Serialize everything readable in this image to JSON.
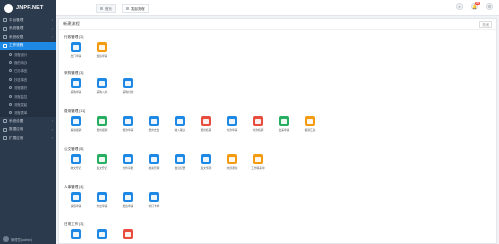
{
  "brand": {
    "name": "JNPF.NET"
  },
  "sidebar": {
    "items": [
      {
        "label": "平台管理",
        "active": false
      },
      {
        "label": "系统管理",
        "active": false
      },
      {
        "label": "系统权限",
        "active": false
      },
      {
        "label": "工作流程",
        "active": true
      }
    ],
    "subitems": [
      {
        "label": "流程设计"
      },
      {
        "label": "我的待办"
      },
      {
        "label": "已办事宜"
      },
      {
        "label": "抄送事宜"
      },
      {
        "label": "流程委托"
      },
      {
        "label": "流程监控"
      },
      {
        "label": "流程发起"
      },
      {
        "label": "流程表单"
      }
    ],
    "more_items": [
      {
        "label": "系统设置"
      },
      {
        "label": "数据应用"
      },
      {
        "label": "扩展应用"
      }
    ],
    "footer_user": "管理员(admin)"
  },
  "topbar": {
    "tabs": [
      {
        "label": "首页"
      },
      {
        "label": "发起流程",
        "active": true
      }
    ],
    "notification_count": "99"
  },
  "panel": {
    "title": "新建流程",
    "close_label": "关闭"
  },
  "sections": [
    {
      "title": "行政管理 [2]",
      "apps": [
        {
          "label": "出门申请",
          "color": "#1e88e5"
        },
        {
          "label": "加班申请",
          "color": "#f39c12"
        }
      ]
    },
    {
      "title": "采购管理 [3]",
      "apps": [
        {
          "label": "采购申请",
          "color": "#1e88e5"
        },
        {
          "label": "采购入库",
          "color": "#1e88e5"
        },
        {
          "label": "采购付款",
          "color": "#1e88e5"
        }
      ]
    },
    {
      "title": "费用管理 [11]",
      "apps": [
        {
          "label": "差旅报销",
          "color": "#1e88e5"
        },
        {
          "label": "费用报销",
          "color": "#27ae60"
        },
        {
          "label": "借款申请",
          "color": "#1e88e5"
        },
        {
          "label": "费用支出",
          "color": "#1e88e5"
        },
        {
          "label": "收入确认",
          "color": "#1e88e5"
        },
        {
          "label": "费用核算",
          "color": "#e74c3c"
        },
        {
          "label": "付款申请",
          "color": "#1e88e5"
        },
        {
          "label": "付款核销",
          "color": "#e74c3c"
        },
        {
          "label": "出差申请",
          "color": "#27ae60"
        },
        {
          "label": "报销汇总",
          "color": "#f39c12"
        }
      ]
    },
    {
      "title": "公文管理 [8]",
      "apps": [
        {
          "label": "收文登记",
          "color": "#1e88e5"
        },
        {
          "label": "发文登记",
          "color": "#27ae60"
        },
        {
          "label": "文件审批",
          "color": "#1e88e5"
        },
        {
          "label": "档案管理",
          "color": "#1e88e5"
        },
        {
          "label": "会议纪要",
          "color": "#1e88e5"
        },
        {
          "label": "发文传阅",
          "color": "#1e88e5"
        },
        {
          "label": "内部通知",
          "color": "#f39c12"
        },
        {
          "label": "工作联系单",
          "color": "#f39c12"
        }
      ]
    },
    {
      "title": "人事管理 [4]",
      "apps": [
        {
          "label": "请假申请",
          "color": "#1e88e5"
        },
        {
          "label": "外出申请",
          "color": "#1e88e5"
        },
        {
          "label": "加班申请",
          "color": "#1e88e5"
        },
        {
          "label": "补打卡单",
          "color": "#1e88e5"
        }
      ]
    },
    {
      "title": "日常工作 [3]",
      "apps": [
        {
          "label": "",
          "color": "#1e88e5"
        },
        {
          "label": "",
          "color": "#1e88e5"
        },
        {
          "label": "",
          "color": "#e74c3c"
        }
      ]
    }
  ]
}
